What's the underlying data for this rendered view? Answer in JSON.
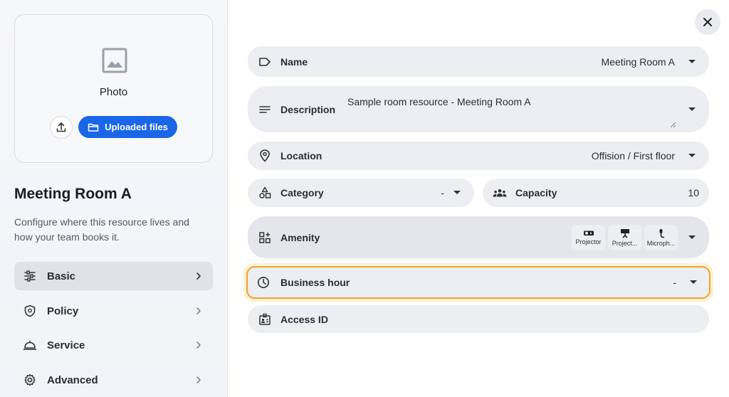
{
  "sidebar": {
    "photo_label": "Photo",
    "uploaded_files_label": "Uploaded files",
    "resource_title": "Meeting Room A",
    "resource_description": "Configure where this resource lives and how your team books it.",
    "nav": [
      {
        "label": "Basic",
        "icon": "sliders-icon",
        "active": true
      },
      {
        "label": "Policy",
        "icon": "shield-icon",
        "active": false
      },
      {
        "label": "Service",
        "icon": "service-bell-icon",
        "active": false
      },
      {
        "label": "Advanced",
        "icon": "gear-icon",
        "active": false
      }
    ]
  },
  "form": {
    "name": {
      "label": "Name",
      "value": "Meeting Room A"
    },
    "description": {
      "label": "Description",
      "value": "Sample room resource - Meeting Room A"
    },
    "location": {
      "label": "Location",
      "value": "Offision / First floor"
    },
    "category": {
      "label": "Category",
      "value": "-"
    },
    "capacity": {
      "label": "Capacity",
      "value": "10"
    },
    "amenity": {
      "label": "Amenity",
      "items": [
        {
          "label": "Projector",
          "icon": "projector-icon"
        },
        {
          "label": "Project...",
          "icon": "projector-screen-icon"
        },
        {
          "label": "Microph...",
          "icon": "microphone-icon"
        }
      ]
    },
    "business_hour": {
      "label": "Business hour",
      "value": "-"
    },
    "access_id": {
      "label": "Access ID"
    }
  },
  "colors": {
    "primary": "#1a66e8",
    "highlight_border": "#f0a22a",
    "field_bg": "#eceef1"
  }
}
